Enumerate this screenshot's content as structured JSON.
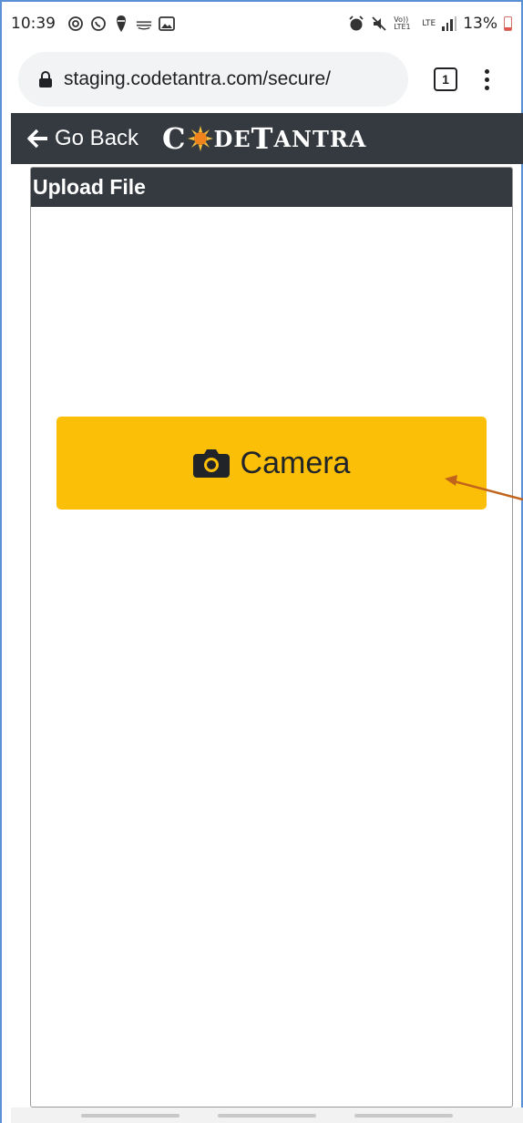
{
  "status_bar": {
    "time": "10:39",
    "battery_percent": "13%",
    "network_text": "LTE",
    "volte_text": "Vo)) LTE1",
    "left_icons": [
      "at-sign-icon",
      "whatsapp-icon",
      "swiggy-icon",
      "amazon-icon",
      "gallery-icon"
    ],
    "right_icons": [
      "alarm-icon",
      "mute-icon",
      "volte-icon",
      "lte-data-icon",
      "signal-icon",
      "battery-icon"
    ]
  },
  "browser": {
    "url": "staging.codetantra.com/secure/",
    "tab_count": "1"
  },
  "app_header": {
    "back_label": "Go Back",
    "brand_parts": [
      "C",
      "DE",
      "T",
      "ANTRA"
    ],
    "brand_colors": {
      "header_bg": "#343a40",
      "sun": "#f39c12"
    }
  },
  "upload_panel": {
    "title": "Upload File",
    "camera_label": "Camera",
    "button_color": "#fcbf07"
  },
  "annotation": {
    "arrow_color": "#c0641c"
  }
}
